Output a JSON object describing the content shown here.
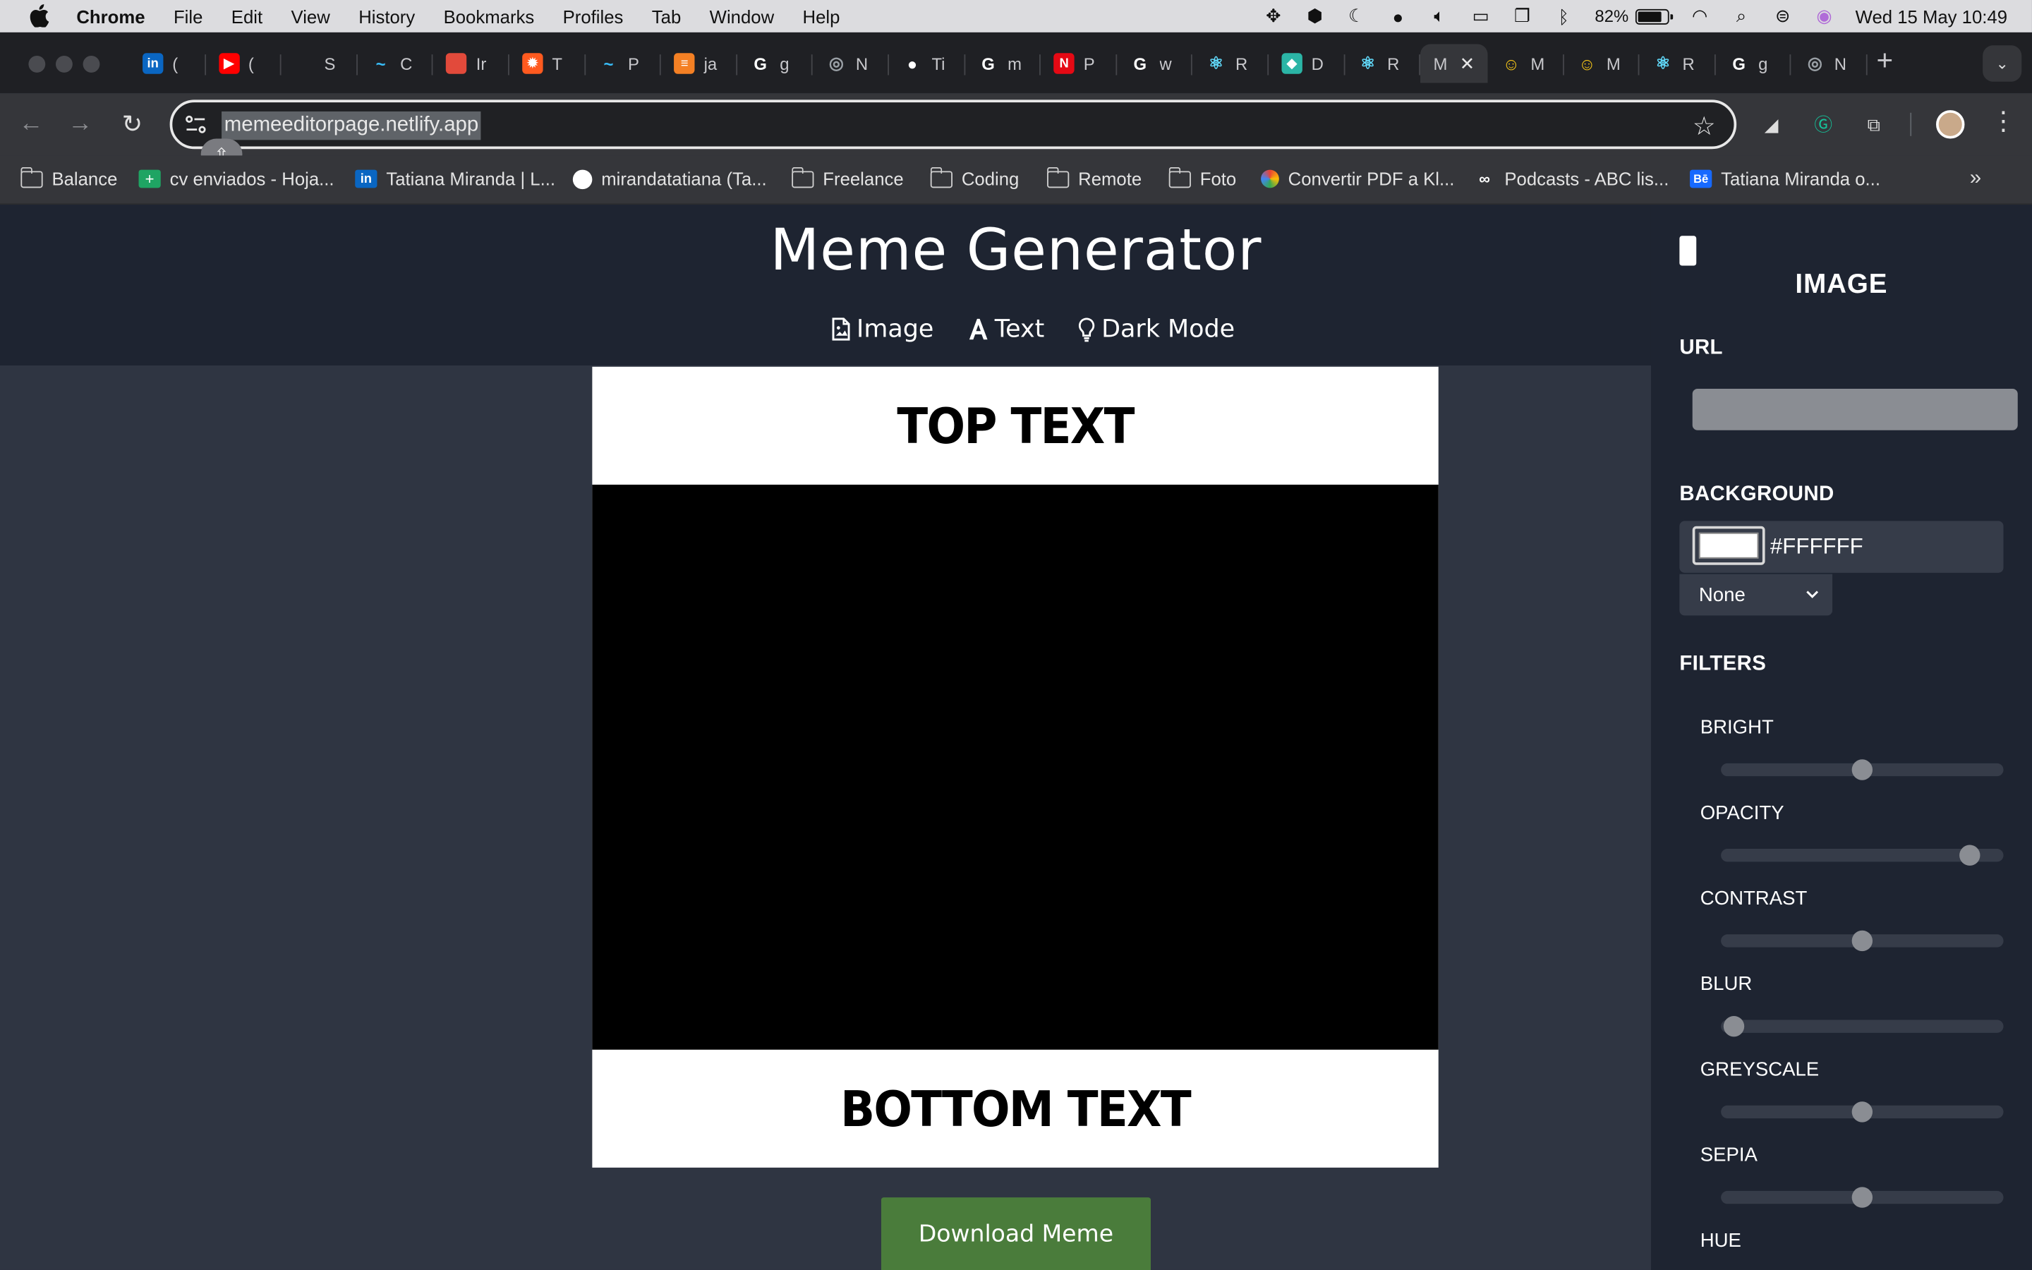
{
  "menubar": {
    "app_name": "Chrome",
    "items": [
      "File",
      "Edit",
      "View",
      "History",
      "Bookmarks",
      "Profiles",
      "Tab",
      "Window",
      "Help"
    ],
    "battery_percent": "82%",
    "battery_level": 0.82,
    "clock": "Wed 15 May  10:49"
  },
  "tabs": [
    {
      "icon": "linkedin-icon",
      "title": "(",
      "color": "#0a66c2",
      "glyph": "in"
    },
    {
      "icon": "youtube-icon",
      "title": "(",
      "color": "#ff0000",
      "glyph": "▶"
    },
    {
      "icon": "chatgpt-icon",
      "title": "S",
      "color": "#ffffff",
      "glyph": ""
    },
    {
      "icon": "tailwind-icon",
      "title": "C",
      "color": "#38bdf8",
      "glyph": "~"
    },
    {
      "icon": "document-icon",
      "title": "Ir",
      "color": "#e24a3b",
      "glyph": ""
    },
    {
      "icon": "sun-icon",
      "title": "T",
      "color": "#ff5a1f",
      "glyph": "✹"
    },
    {
      "icon": "tailwind-icon",
      "title": "P",
      "color": "#38bdf8",
      "glyph": "~"
    },
    {
      "icon": "stackoverflow-icon",
      "title": "ja",
      "color": "#f48024",
      "glyph": "≡"
    },
    {
      "icon": "google-icon",
      "title": "g",
      "color": "#ffffff",
      "glyph": "G"
    },
    {
      "icon": "chrome-icon",
      "title": "N",
      "color": "#9aa0a6",
      "glyph": "◎"
    },
    {
      "icon": "github-icon",
      "title": "Ti",
      "color": "#ffffff",
      "glyph": "●"
    },
    {
      "icon": "google-icon",
      "title": "m",
      "color": "#ffffff",
      "glyph": "G"
    },
    {
      "icon": "netflix-icon",
      "title": "P",
      "color": "#e50914",
      "glyph": "N"
    },
    {
      "icon": "google-icon",
      "title": "w",
      "color": "#ffffff",
      "glyph": "G"
    },
    {
      "icon": "react-icon",
      "title": "R",
      "color": "#61dafb",
      "glyph": "⚛"
    },
    {
      "icon": "diamond-icon",
      "title": "D",
      "color": "#2bb5a6",
      "glyph": "◆"
    },
    {
      "icon": "react-icon",
      "title": "R",
      "color": "#61dafb",
      "glyph": "⚛"
    },
    {
      "icon": "none",
      "title": "M",
      "color": "#35363a",
      "glyph": "",
      "active": true
    },
    {
      "icon": "emoji-icon",
      "title": "M",
      "color": "#f5c518",
      "glyph": "☺"
    },
    {
      "icon": "emoji-icon",
      "title": "M",
      "color": "#f5c518",
      "glyph": "☺"
    },
    {
      "icon": "react-icon",
      "title": "R",
      "color": "#61dafb",
      "glyph": "⚛"
    },
    {
      "icon": "google-icon",
      "title": "g",
      "color": "#ffffff",
      "glyph": "G"
    },
    {
      "icon": "chrome-icon",
      "title": "N",
      "color": "#9aa0a6",
      "glyph": "◎"
    }
  ],
  "address_bar": {
    "url": "memeeditorpage.netlify.app"
  },
  "bookmarks": [
    {
      "icon": "folder-icon",
      "label": "Balance"
    },
    {
      "icon": "sheets-icon",
      "label": "cv enviados - Hoja..."
    },
    {
      "icon": "linkedin-icon",
      "label": "Tatiana Miranda | L..."
    },
    {
      "icon": "github-icon",
      "label": "mirandatatiana (Ta..."
    },
    {
      "icon": "folder-icon",
      "label": "Freelance"
    },
    {
      "icon": "folder-icon",
      "label": "Coding"
    },
    {
      "icon": "folder-icon",
      "label": "Remote"
    },
    {
      "icon": "folder-icon",
      "label": "Foto"
    },
    {
      "icon": "pdf-converter-icon",
      "label": "Convertir PDF a Kl..."
    },
    {
      "icon": "abc-icon",
      "label": "Podcasts - ABC lis..."
    },
    {
      "icon": "behance-icon",
      "label": "Tatiana Miranda o..."
    }
  ],
  "app": {
    "title": "Meme Generator",
    "nav": {
      "image": "Image",
      "text": "Text",
      "dark_mode": "Dark Mode"
    },
    "meme": {
      "top_text": "TOP TEXT",
      "bottom_text": "BOTTOM TEXT"
    },
    "download_label": "Download Meme"
  },
  "panel": {
    "title": "IMAGE",
    "url_label": "URL",
    "url_value": "",
    "background_label": "BACKGROUND",
    "background_color": "#FFFFFF",
    "blend_mode": "None",
    "filters_label": "FILTERS",
    "filters": [
      {
        "label": "BRIGHT",
        "value": 0.5
      },
      {
        "label": "OPACITY",
        "value": 0.92
      },
      {
        "label": "CONTRAST",
        "value": 0.5
      },
      {
        "label": "BLUR",
        "value": 0.0
      },
      {
        "label": "GREYSCALE",
        "value": 0.5
      },
      {
        "label": "SEPIA",
        "value": 0.5
      },
      {
        "label": "HUE",
        "value": null
      }
    ]
  },
  "colors": {
    "header_bg": "#1e2431",
    "page_bg": "#2f3542",
    "download_bg": "#4a7c3b"
  }
}
